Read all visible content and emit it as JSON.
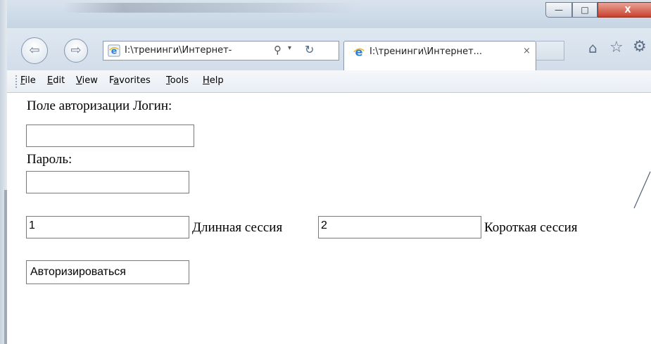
{
  "window": {
    "minimize_glyph": "—",
    "maximize_glyph": "□",
    "close_glyph": "X"
  },
  "navigation": {
    "back_glyph": "⇦",
    "forward_glyph": "⇨",
    "address_text": "I:\\тренинги\\Интернет-",
    "search_glyph": "⚲",
    "dropdown_glyph": "▾",
    "refresh_glyph": "↻",
    "home_glyph": "⌂",
    "favorites_glyph": "☆",
    "tools_glyph": "⚙",
    "icons": [
      "back-icon",
      "forward-icon",
      "ie-logo-icon",
      "search-icon",
      "dropdown-icon",
      "refresh-icon",
      "home-icon",
      "star-icon",
      "gear-icon"
    ]
  },
  "tab": {
    "title": "I:\\тренинги\\Интернет...",
    "close_glyph": "×"
  },
  "menu": {
    "items": [
      {
        "accel": "F",
        "rest": "ile"
      },
      {
        "accel": "E",
        "rest": "dit"
      },
      {
        "accel": "V",
        "rest": "iew"
      },
      {
        "prefix": "F",
        "accel": "a",
        "rest": "vorites"
      },
      {
        "accel": "T",
        "rest": "ools"
      },
      {
        "accel": "H",
        "rest": "elp"
      }
    ]
  },
  "form": {
    "login_label": "Поле авторизации Логин:",
    "login_value": "",
    "password_label": "Пароль:",
    "password_value": "",
    "session_long_value": "1",
    "session_long_label": "Длинная сессия",
    "session_short_value": "2",
    "session_short_label": "Короткая сессия",
    "submit_label": "Авторизироваться"
  },
  "colors": {
    "chrome_blue": "#d2ddea",
    "close_red": "#c8412d",
    "ie_blue": "#2a7fd4",
    "ie_gold": "#f2b51d"
  }
}
